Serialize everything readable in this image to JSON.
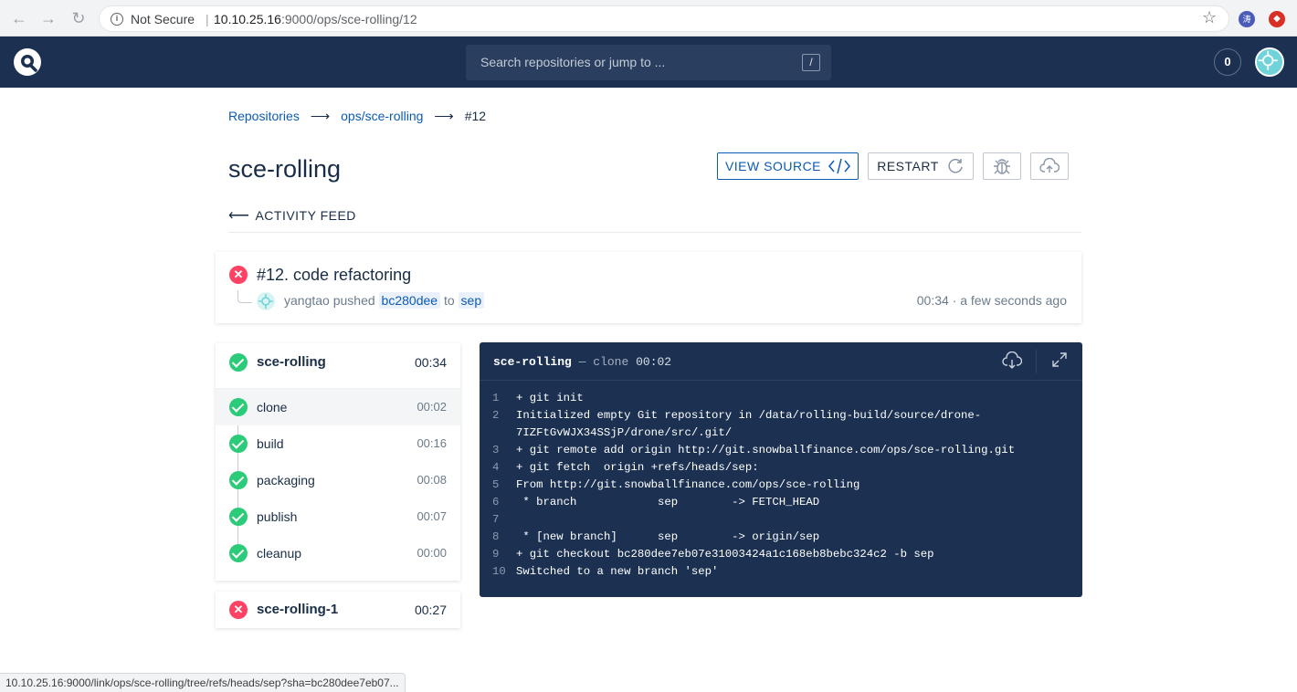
{
  "browser": {
    "security_label": "Not Secure",
    "url_host": "10.10.25.16",
    "url_rest": ":9000/ops/sce-rolling/12",
    "ext1_label": "涛",
    "status_url": "10.10.25.16:9000/link/ops/sce-rolling/tree/refs/heads/sep?sha=bc280dee7eb07..."
  },
  "header": {
    "search_placeholder": "Search repositories or jump to ...",
    "search_shortcut": "/",
    "notification_count": "0"
  },
  "breadcrumb": {
    "items": [
      "Repositories",
      "ops/sce-rolling"
    ],
    "current": "#12"
  },
  "page": {
    "title": "sce-rolling",
    "view_source_label": "VIEW SOURCE",
    "restart_label": "RESTART",
    "activity_label": "ACTIVITY FEED"
  },
  "build": {
    "title": "#12. code refactoring",
    "author": "yangtao",
    "action": "pushed",
    "commit": "bc280dee",
    "to_word": "to",
    "branch": "sep",
    "time": "00:34 · a few seconds ago"
  },
  "stages": [
    {
      "name": "sce-rolling",
      "duration": "00:34",
      "status": "success",
      "steps": [
        {
          "name": "clone",
          "duration": "00:02"
        },
        {
          "name": "build",
          "duration": "00:16"
        },
        {
          "name": "packaging",
          "duration": "00:08"
        },
        {
          "name": "publish",
          "duration": "00:07"
        },
        {
          "name": "cleanup",
          "duration": "00:00"
        }
      ]
    },
    {
      "name": "sce-rolling-1",
      "duration": "00:27",
      "status": "failure"
    }
  ],
  "log": {
    "stage": "sce-rolling",
    "dash": "—",
    "step": "clone",
    "duration": "00:02",
    "lines": [
      {
        "n": "1",
        "t": "+ git init"
      },
      {
        "n": "2",
        "t": "Initialized empty Git repository in /data/rolling-build/source/drone-7IZFtGvWJX34SSjP/drone/src/.git/"
      },
      {
        "n": "3",
        "t": "+ git remote add origin http://git.snowballfinance.com/ops/sce-rolling.git"
      },
      {
        "n": "4",
        "t": "+ git fetch  origin +refs/heads/sep:"
      },
      {
        "n": "5",
        "t": "From http://git.snowballfinance.com/ops/sce-rolling"
      },
      {
        "n": "6",
        "t": " * branch            sep        -> FETCH_HEAD"
      },
      {
        "n": "7",
        "t": ""
      },
      {
        "n": "8",
        "t": " * [new branch]      sep        -> origin/sep"
      },
      {
        "n": "9",
        "t": "+ git checkout bc280dee7eb07e31003424a1c168eb8bebc324c2 -b sep"
      },
      {
        "n": "10",
        "t": "Switched to a new branch 'sep'"
      }
    ]
  },
  "colors": {
    "header_bg": "#1c3151",
    "link": "#0c5bb3",
    "success": "#2ccb7a",
    "failure": "#ff4164"
  }
}
